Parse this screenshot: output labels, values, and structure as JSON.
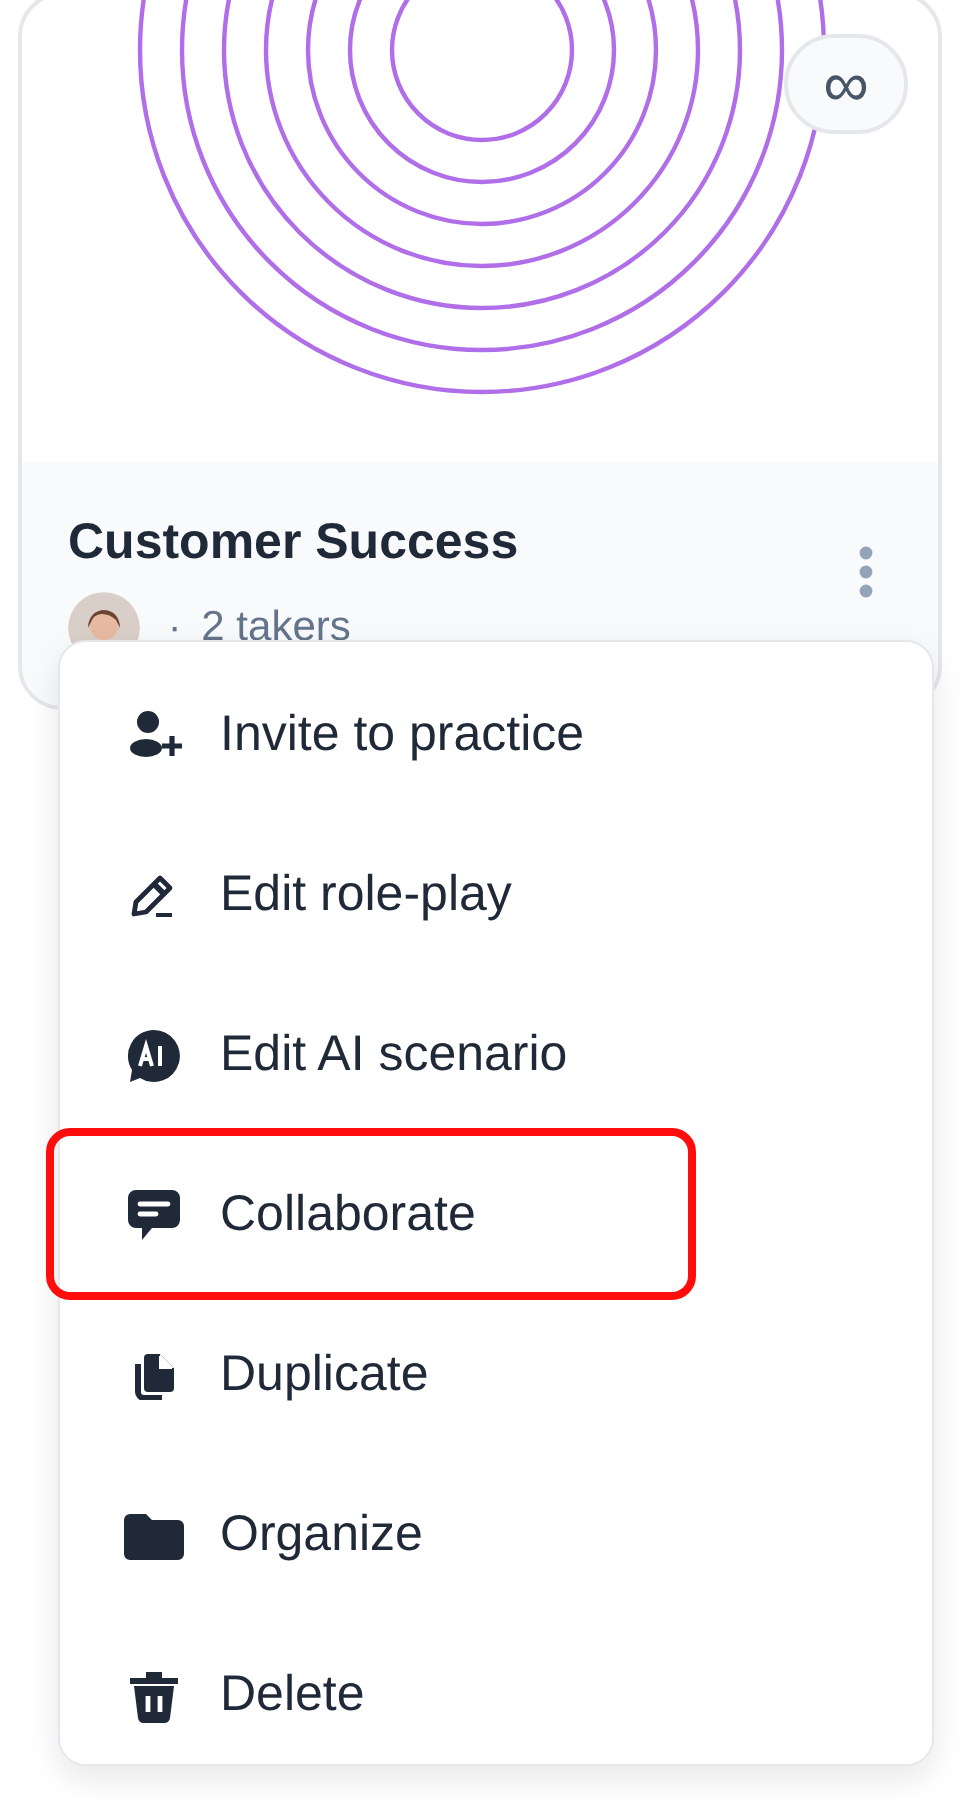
{
  "card": {
    "badge": "∞",
    "title": "Customer Success",
    "takers": "2 takers",
    "separator": "·"
  },
  "menu": {
    "items": [
      {
        "label": "Invite to practice",
        "highlighted": false
      },
      {
        "label": "Edit role-play",
        "highlighted": false
      },
      {
        "label": "Edit AI scenario",
        "highlighted": false
      },
      {
        "label": "Collaborate",
        "highlighted": true
      },
      {
        "label": "Duplicate",
        "highlighted": false
      },
      {
        "label": "Organize",
        "highlighted": false
      },
      {
        "label": "Delete",
        "highlighted": false
      }
    ]
  }
}
